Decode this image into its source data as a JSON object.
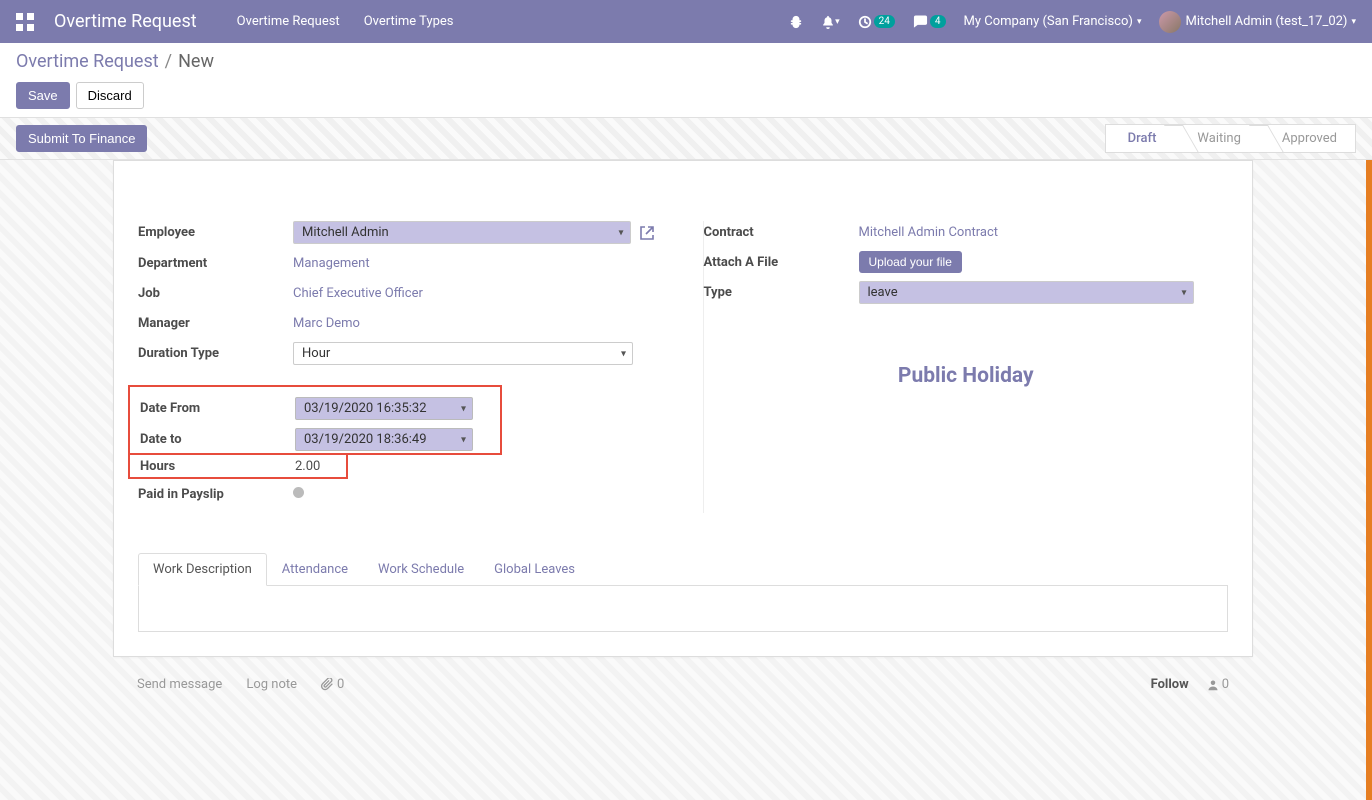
{
  "navbar": {
    "app_title": "Overtime Request",
    "menu": [
      "Overtime Request",
      "Overtime Types"
    ],
    "activities_count": "24",
    "messages_count": "4",
    "company": "My Company (San Francisco)",
    "user": "Mitchell Admin (test_17_02)"
  },
  "breadcrumb": {
    "parent": "Overtime Request",
    "current": "New"
  },
  "buttons": {
    "save": "Save",
    "discard": "Discard",
    "submit": "Submit To Finance"
  },
  "stages": [
    "Draft",
    "Waiting",
    "Approved"
  ],
  "active_stage": "Draft",
  "form": {
    "left": {
      "employee_label": "Employee",
      "employee_value": "Mitchell Admin",
      "department_label": "Department",
      "department_value": "Management",
      "job_label": "Job",
      "job_value": "Chief Executive Officer",
      "manager_label": "Manager",
      "manager_value": "Marc Demo",
      "duration_type_label": "Duration Type",
      "duration_type_value": "Hour",
      "date_from_label": "Date From",
      "date_from_value": "03/19/2020 16:35:32",
      "date_to_label": "Date to",
      "date_to_value": "03/19/2020 18:36:49",
      "hours_label": "Hours",
      "hours_value": "2.00",
      "paid_label": "Paid in Payslip"
    },
    "right": {
      "contract_label": "Contract",
      "contract_value": "Mitchell Admin Contract",
      "attach_label": "Attach A File",
      "upload_label": "Upload your file",
      "type_label": "Type",
      "type_value": "leave",
      "center_title": "Public Holiday"
    }
  },
  "tabs": [
    "Work Description",
    "Attendance",
    "Work Schedule",
    "Global Leaves"
  ],
  "active_tab": "Work Description",
  "chatter": {
    "send": "Send message",
    "log": "Log note",
    "attach_count": "0",
    "follow": "Follow",
    "followers": "0"
  }
}
